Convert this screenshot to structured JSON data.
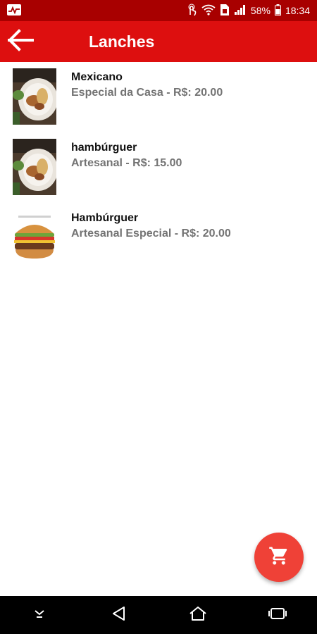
{
  "status": {
    "battery": "58%",
    "time": "18:34",
    "icons": [
      "activity-icon",
      "touch-icon",
      "wifi-icon",
      "sim-icon",
      "signal-icon",
      "battery-icon"
    ]
  },
  "appbar": {
    "title": "Lanches",
    "back_icon": "arrow-left-icon"
  },
  "items": [
    {
      "title": "Mexicano",
      "subtitle": "Especial da Casa - R$: 20.00",
      "image": "food-plate"
    },
    {
      "title": "hambúrguer",
      "subtitle": "Artesanal - R$: 15.00",
      "image": "food-plate"
    },
    {
      "title": "Hambúrguer",
      "subtitle": "Artesanal Especial - R$: 20.00",
      "image": "burger"
    }
  ],
  "fab": {
    "icon": "cart-icon"
  },
  "colors": {
    "status_bar": "#a80000",
    "app_bar": "#dd0f0f",
    "fab": "#ef4137",
    "subtitle": "#737373"
  },
  "navbar": {
    "icons": [
      "chevron-down-icon",
      "back-triangle-icon",
      "home-icon",
      "recents-icon"
    ]
  }
}
